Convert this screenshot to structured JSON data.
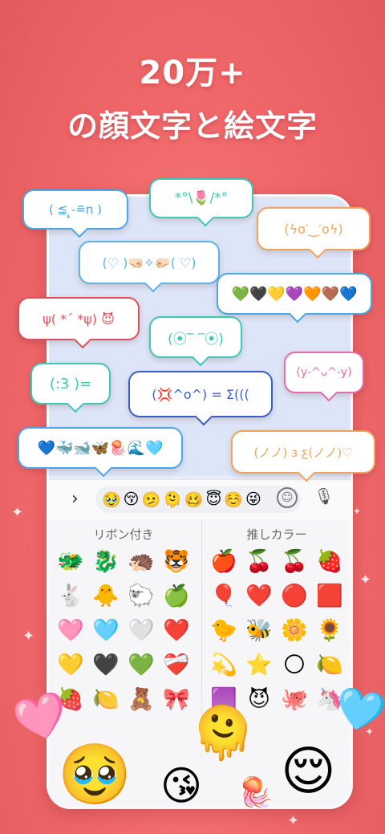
{
  "headline": {
    "line1": "20万+",
    "line2": "の顔文字と絵文字"
  },
  "bubbles": [
    {
      "text": "( ≦ ̣̥-≘n )",
      "color": "#4aa6e8"
    },
    {
      "text": "*°\\🌷/*°",
      "color": "#3ec7b4"
    },
    {
      "text": "(ϟo′‿′oϟ)",
      "color": "#f0a45c"
    },
    {
      "text": "(♡  )🤜🏻✧🤛🏻(  ♡)",
      "color": "#5ab4e8"
    },
    {
      "text": "💚🖤💛💜🧡🤎💙",
      "color": "#4aa6e8"
    },
    {
      "text": "ψ( *´ *ψ)  😈",
      "color": "#e0505a"
    },
    {
      "text": "(⦿‾ ‾⦿)",
      "color": "#3ec7b4"
    },
    {
      "text": "(:3 )=",
      "color": "#3ec7b4"
    },
    {
      "text": "(y-^ᴗ^-y)",
      "color": "#e86aa8"
    },
    {
      "text": "(💢^o^)  = Σ(((",
      "color": "#3a5ec8"
    },
    {
      "text": "💙🐳🐋🦋🪼🌊🩵",
      "color": "#4aa6e8"
    },
    {
      "text": "(ノノ) ɜ ƹ(ノノ)♡",
      "color": "#f0a45c"
    }
  ],
  "keyboard": {
    "chevron": "›",
    "suggestions": [
      "🥹",
      "😚",
      "🫤",
      "🫠",
      "🥴",
      "😇",
      "☺️",
      "😜"
    ],
    "smile_icon": "☺",
    "mic_icon": "🎙"
  },
  "emoji_panel": {
    "left_title": "リボン付き",
    "right_title": "推しカラー",
    "left_emojis": [
      "🐲",
      "🐉",
      "🦔",
      "🐯",
      "🐇",
      "🐥",
      "🐑",
      "🍏",
      "🩷",
      "🩵",
      "🤍",
      "❤️",
      "💛",
      "🖤",
      "💚",
      "❤️‍🩹",
      "🍓",
      "🍋",
      "🧸",
      "🎀"
    ],
    "right_emojis": [
      "🍎",
      "🍒",
      "🍒",
      "🍓",
      "🎈",
      "❤️",
      "🔴",
      "🟥",
      "🐤",
      "🐝",
      "🌼",
      "🌻",
      "💫",
      "⭐",
      "🌕",
      "🍋",
      "🟪",
      "😈",
      "🐙",
      "🦄"
    ]
  },
  "decor": [
    "🩷",
    "🥹",
    "😘",
    "🫠",
    "🪼",
    "😌",
    "🩵"
  ]
}
